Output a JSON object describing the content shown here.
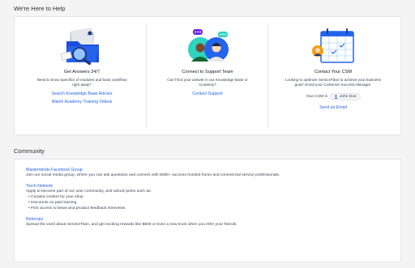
{
  "help_section": {
    "title": "We're Here to Help",
    "columns": [
      {
        "title": "Get Answers 24/7",
        "description": "Need to know specifics of modules and basic workflow right away?",
        "links": [
          "Search Knowledge Base Articles",
          "Watch Academy Training Videos"
        ]
      },
      {
        "title": "Connect to Support Team",
        "description": "Can't find your answer in our Knowledge Base or Academy?",
        "links": [
          "Contact Support"
        ]
      },
      {
        "title": "Contact Your CSM",
        "description": "Looking to optimize ServiceTitan to achieve your business goal? Email your Customer Success Manager.",
        "csm_label": "Your CSM is",
        "csm_name": "John Doe",
        "links": [
          "Send an Email"
        ]
      }
    ]
  },
  "community_section": {
    "title": "Community",
    "items": [
      {
        "link": "Masterminds Facebook Group",
        "text": "Join our social media group, where you can ask questions and connect with 5000+ success-minded home and commercial service professionals."
      },
      {
        "link": "Torch Network",
        "text": "Apply to become part of our user community, and unlock perks such as:",
        "bullets": [
          "Curated content for your shop",
          "Discounts on paid training",
          "First access to betas and product feedback interviews"
        ]
      },
      {
        "link": "Referrals",
        "text": "Spread the word about ServiceTitan, and get exciting rewards like $500 or even a new truck when you refer your friends."
      }
    ]
  },
  "colors": {
    "link": "#2563eb",
    "accent_blue": "#1d4ed8",
    "purple": "#6d28d9",
    "teal": "#2dd4bf"
  }
}
